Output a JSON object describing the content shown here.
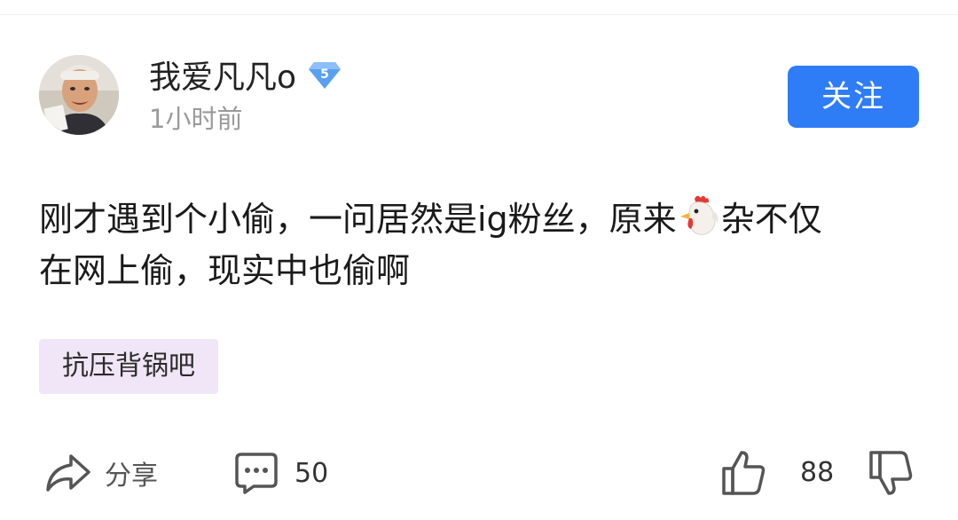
{
  "post": {
    "author": {
      "name": "我爱凡凡o",
      "level": "5",
      "avatar": "avatar-photo"
    },
    "time": "1小时前",
    "follow_label": "关注",
    "content": {
      "line1_part1": "刚才遇到个小偷，一问居然是ig粉丝，原来",
      "emoji": "rooster-emoji",
      "line1_part2": "杂不仅",
      "line2": "在网上偷，现实中也偷啊"
    },
    "topic_tag": "抗压背锅吧",
    "actions": {
      "share_label": "分享",
      "comment_count": "50",
      "like_count": "88"
    }
  },
  "colors": {
    "accent": "#2e7cf6",
    "tag_background": "#f1e6f7",
    "secondary_text": "#9a9a9a",
    "badge": "#5aa0f2"
  },
  "icons": [
    "share-icon",
    "comment-icon",
    "thumbs-up-icon",
    "thumbs-down-icon",
    "level-badge-icon"
  ]
}
